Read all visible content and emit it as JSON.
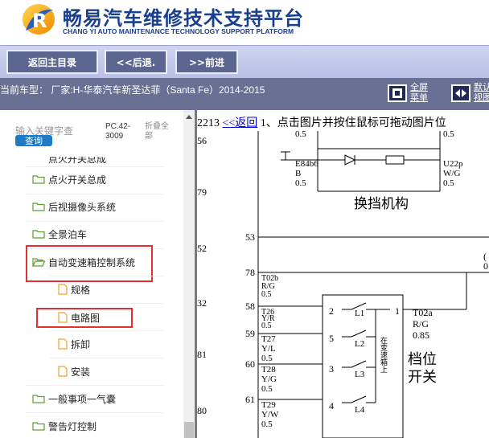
{
  "header": {
    "title": "畅易汽车维修技术支持平台",
    "subtitle": "CHANG YI AUTO MAINTENANCE TECHNOLOGY SUPPORT PLATFORM"
  },
  "toolbar": {
    "home": "返回主目录",
    "back": "<<后退.",
    "forward": ">>前进"
  },
  "infobar": {
    "model": "当前车型：  厂家:H-华泰汽车新圣达菲（Santa Fe）2014-2015",
    "fullscreen": [
      "全屏",
      "菜单"
    ],
    "default": [
      "默认",
      "视图"
    ]
  },
  "sidebar": {
    "search_placeholder": "输入关键字查",
    "search_button": "查询",
    "pc_code": [
      "PC.42-",
      "3009"
    ],
    "collapse_all": [
      "折叠全",
      "部"
    ],
    "partial_item": "点火开关总成",
    "items": [
      {
        "label": "点火开关总成",
        "type": "folder"
      },
      {
        "label": "后视摄像头系统",
        "type": "folder"
      },
      {
        "label": "全景泊车",
        "type": "folder"
      },
      {
        "label": "自动变速箱控制系统",
        "type": "folder-open",
        "highlighted": true
      },
      {
        "label": "规格",
        "type": "doc"
      },
      {
        "label": "电路图",
        "type": "doc",
        "highlighted": true
      },
      {
        "label": "拆卸",
        "type": "doc"
      },
      {
        "label": "安装",
        "type": "doc"
      },
      {
        "label": "一般事项一气囊",
        "type": "folder"
      },
      {
        "label": "警告灯控制",
        "type": "folder"
      }
    ]
  },
  "content": {
    "doc_number": "2213",
    "back_link": "<<返回",
    "instruction": "1、点击图片并按住鼠标可拖动图片位",
    "diagram": {
      "row_numbers": [
        "56",
        "79",
        "52",
        "32",
        "81",
        "80"
      ],
      "wire_numbers": [
        "53",
        "78",
        "58",
        "59",
        "60",
        "61"
      ],
      "top_labels": [
        "0.5",
        "0.5"
      ],
      "e84_label": [
        "E84b6",
        "B",
        "0.5"
      ],
      "u22_label": [
        "U22p",
        "W/G",
        "0.5"
      ],
      "mechanism_title": "换挡机构",
      "t02b": [
        "T02b",
        "R/G",
        "0.5"
      ],
      "t26": [
        "T26",
        "Y/R",
        "0.5"
      ],
      "t27": [
        "T27",
        "Y/L",
        "0.5"
      ],
      "t28": [
        "T28",
        "Y/G",
        "0.5"
      ],
      "t29": [
        "T29",
        "Y/W",
        "0.5"
      ],
      "t02a": [
        "T02a",
        "R/G",
        "0.85"
      ],
      "switch_pins": [
        "2",
        "1",
        "5",
        "3",
        "4"
      ],
      "switch_contacts": [
        "L1",
        "L2",
        "L3",
        "L4"
      ],
      "in_box_note": "在变速箱上",
      "switch_title": [
        "档位",
        "开关"
      ],
      "right_edge": [
        "(",
        "0"
      ]
    }
  },
  "colors": {
    "brand_blue": "#1a3f8f",
    "toolbar_button": "#5a6590",
    "infobar_bg": "#6a7094",
    "highlight_red": "#e03030",
    "search_button": "#1e7bc8"
  }
}
